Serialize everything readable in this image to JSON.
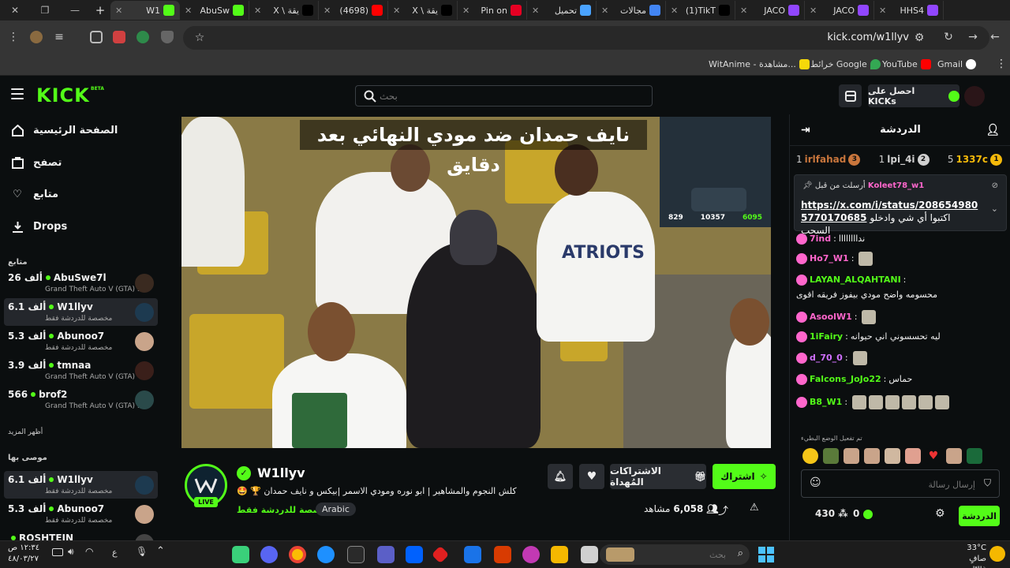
{
  "browser": {
    "tabs": [
      {
        "label": "HHS4",
        "icon": "twitch-icon",
        "color": "#9146ff"
      },
      {
        "label": "JACO",
        "icon": "twitch-icon",
        "color": "#9146ff"
      },
      {
        "label": "JACO",
        "icon": "twitch-icon",
        "color": "#9146ff"
      },
      {
        "label": "(1)TikT",
        "icon": "tiktok-icon",
        "color": "#000000"
      },
      {
        "label": "مجالات",
        "icon": "gemini-icon",
        "color": "#4285f4"
      },
      {
        "label": "تحميل",
        "icon": "diamond-icon",
        "color": "#4aa3ff"
      },
      {
        "label": "Pin on",
        "icon": "pinterest-icon",
        "color": "#e60023"
      },
      {
        "label": "X \\ يقة",
        "icon": "x-icon",
        "color": "#000000"
      },
      {
        "label": "(4698)",
        "icon": "youtube-icon",
        "color": "#ff0000"
      },
      {
        "label": "X \\ يقة",
        "icon": "x-icon",
        "color": "#000000"
      },
      {
        "label": "AbuSw",
        "icon": "kick-icon",
        "color": "#53fc18"
      },
      {
        "label": "W1",
        "icon": "kick-icon",
        "color": "#53fc18"
      }
    ],
    "url": "kick.com/w1llyv",
    "bookmarks": [
      {
        "label": "Gmail",
        "color": "#ffffff"
      },
      {
        "label": "YouTube",
        "color": "#ff0000"
      },
      {
        "label": "خرائط Google",
        "color": "#34a853"
      },
      {
        "label": "WitAnime - مشاهدة...",
        "color": "#f5d90a"
      }
    ]
  },
  "header": {
    "logo": "KICK",
    "logo_badge": "BETA",
    "search_placeholder": "بحث",
    "get_kicks": "احصل على KICKs"
  },
  "sidebar": {
    "nav": [
      {
        "label": "الصفحة الرئيسية",
        "icon": "home-icon"
      },
      {
        "label": "تصفح",
        "icon": "browse-icon"
      },
      {
        "label": "متابع",
        "icon": "heart-icon"
      },
      {
        "label": "Drops",
        "icon": "drops-icon"
      }
    ],
    "following_title": "متابع",
    "following": [
      {
        "viewers": "26 ألف",
        "name": "AbuSwe7l",
        "category": "Grand Theft Auto V (GTA) ...",
        "color": "#3a2a20"
      },
      {
        "viewers": "6.1 ألف",
        "name": "W1llyv",
        "category": "مخصصة للدردشة فقط",
        "color": "#1d3a50"
      },
      {
        "viewers": "5.3 ألف",
        "name": "Abunoo7",
        "category": "مخصصة للدردشة فقط",
        "color": "#c9a48a"
      },
      {
        "viewers": "3.9 ألف",
        "name": "tmnaa",
        "category": "Grand Theft Auto V (GTA)",
        "color": "#3a1f1a"
      },
      {
        "viewers": "566",
        "name": "brof2",
        "category": "Grand Theft Auto V (GTA) ...",
        "color": "#2a4a4a"
      }
    ],
    "show_more": "أظهر المزيد",
    "recommended_title": "موصى بها",
    "recommended": [
      {
        "viewers": "6.1 ألف",
        "name": "W1llyv",
        "category": "مخصصة للدردشة فقط",
        "color": "#1d3a50"
      },
      {
        "viewers": "5.3 ألف",
        "name": "Abunoo7",
        "category": "مخصصة للدردشة فقط",
        "color": "#c9a48a"
      },
      {
        "viewers": "",
        "name": "ROSHTEIN",
        "category": "",
        "color": "#444444"
      }
    ]
  },
  "video": {
    "overlay_title": "نايف حمدان ضد مودي النهائي بعد دقايق",
    "pip_stats": [
      "829",
      "10357",
      "6095"
    ]
  },
  "channel": {
    "name": "W1llyv",
    "live": "LIVE",
    "title": "🤩 🏆 كلش النجوم والمشاهير | ابو نوره ومودي الاسمر |بيكس و نايف حمدان",
    "category": "مخصصة للدردشة فقط",
    "language": "Arabic",
    "subscribe": "اشتراك",
    "gift": "الاشتراكات المُهداة",
    "viewers": "6,058",
    "viewers_label": "مشاهد"
  },
  "chat": {
    "title": "الدردشة",
    "leaderboard": [
      {
        "rank": "1",
        "name": "1337c",
        "count": "5",
        "color": "#f5b90a"
      },
      {
        "rank": "2",
        "name": "lpi_4i",
        "count": "1",
        "color": "#d0d0d0"
      },
      {
        "rank": "3",
        "name": "irlfahad",
        "count": "1",
        "color": "#c9763c"
      }
    ],
    "pinned_by": "Koleet78_w1",
    "pinned_label": "أرسلت من قبل",
    "pinned_link": "https://x.com/i/status/2086549805770170685",
    "pinned_text": "اكتبوا أي شي وادخلو السحب",
    "messages": [
      {
        "user": "7ind",
        "color": "#ff66cc",
        "text": "نداااااااا",
        "emotes": 0
      },
      {
        "user": "Ho7_W1",
        "color": "#ff66cc",
        "text": "",
        "emotes": 1
      },
      {
        "user": "LAYAN_ALQAHTANI",
        "color": "#53fc18",
        "text": "محسومه واضح مودي بيفوز فريقه اقوى",
        "emotes": 0
      },
      {
        "user": "AsoolW1",
        "color": "#ff66cc",
        "text": "",
        "emotes": 1
      },
      {
        "user": "1iFairy",
        "color": "#53fc18",
        "text": "ليه تحسسوني اني حيوانه",
        "emotes": 0
      },
      {
        "user": "d_70_0",
        "color": "#d070ff",
        "text": "",
        "emotes": 1
      },
      {
        "user": "Falcons_JoJo22",
        "color": "#53fc18",
        "text": "حماس",
        "emotes": 0
      },
      {
        "user": "B8_W1",
        "color": "#53fc18",
        "text": "",
        "emotes": 6
      }
    ],
    "mode_text": "تم تفعيل الوضع البطيء",
    "input_placeholder": "إرسال رسالة",
    "send": "الدردشة",
    "kicks": "0",
    "points": "430"
  },
  "taskbar": {
    "time": "١٢:٣٤ ص",
    "date": "٤٨/٠٣/٢٧",
    "lang": "ع",
    "search_placeholder": "بحث",
    "temp": "33°C",
    "weather": "صافٍ غالبًا"
  }
}
